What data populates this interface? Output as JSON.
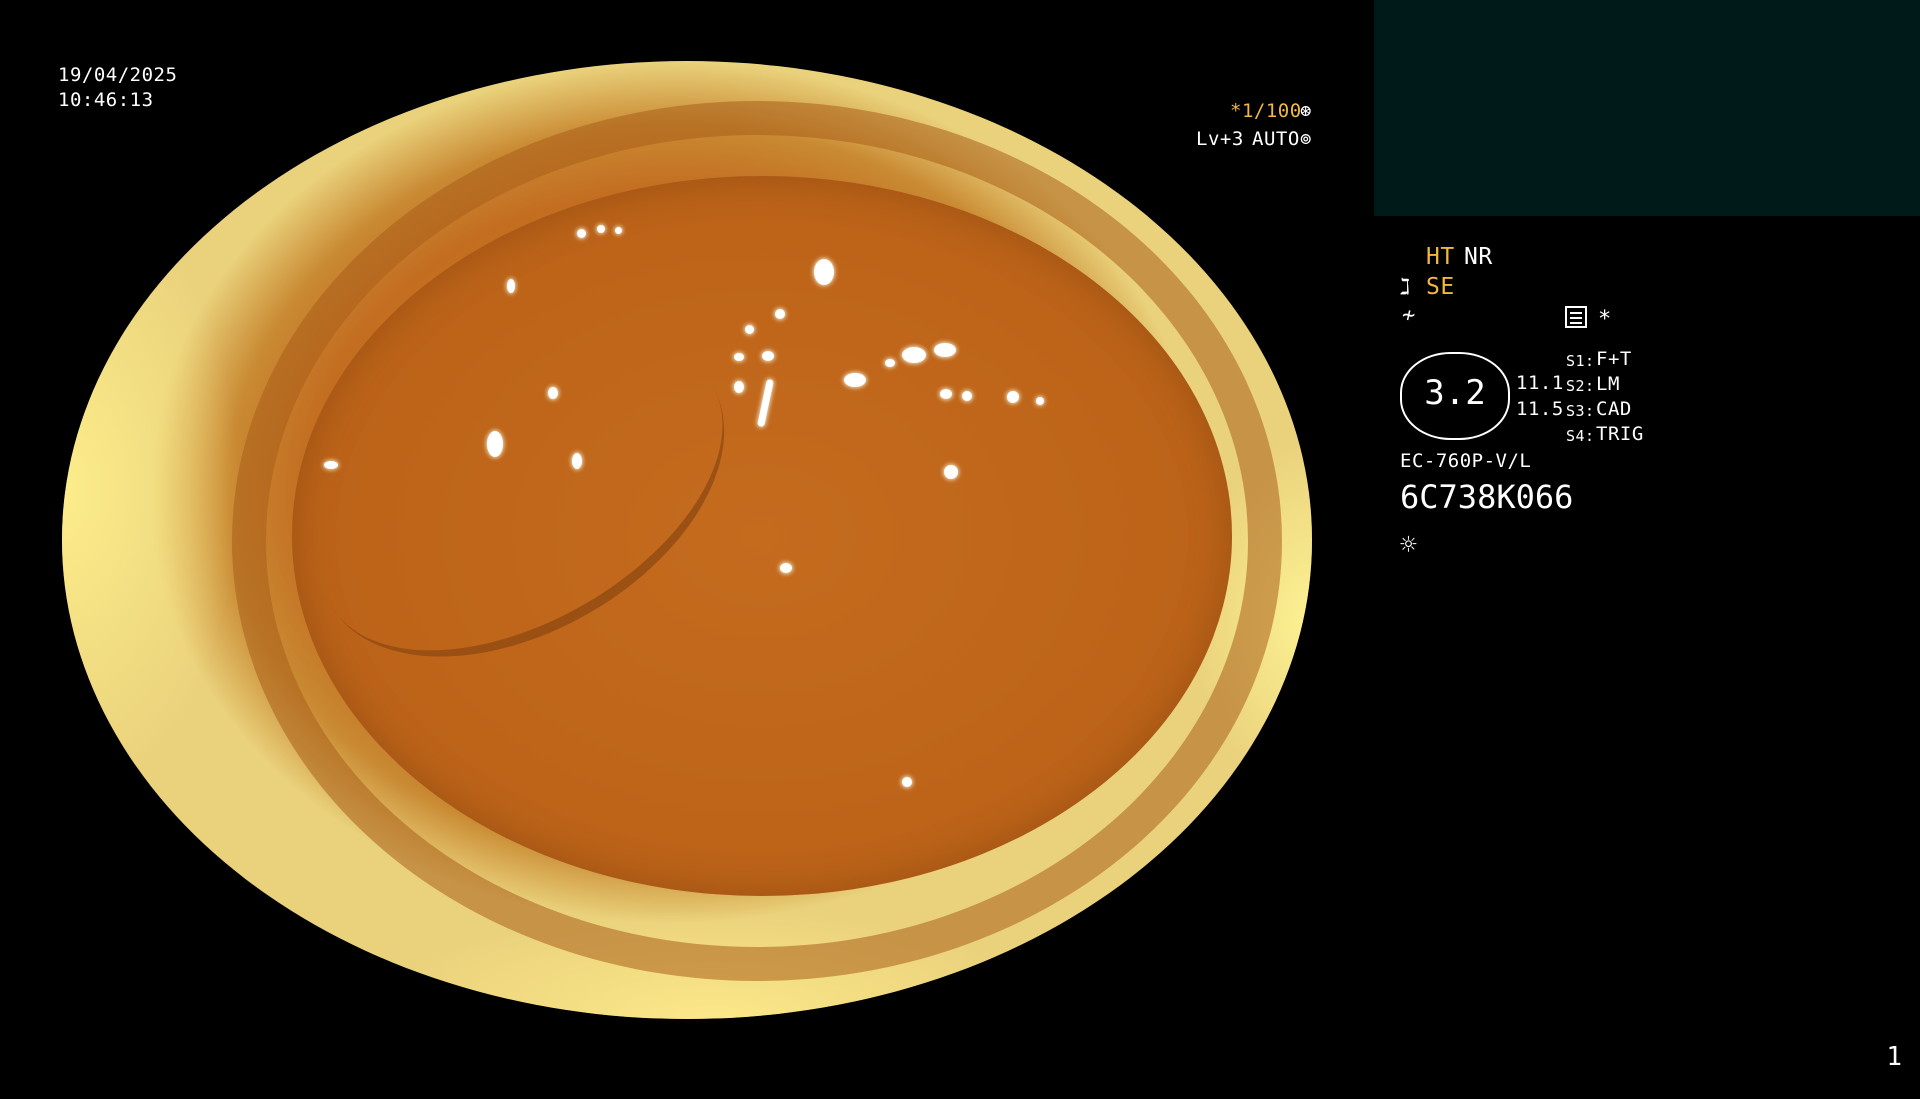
{
  "datetime": {
    "date": "19/04/2025",
    "time": "10:46:13"
  },
  "shutter": {
    "value": "*1/100",
    "icon": "shutter-icon"
  },
  "iris": {
    "level": "Lv+3",
    "mode": "AUTO",
    "icon": "iris-icon"
  },
  "image_modes": {
    "ht": "HT",
    "nr": "NR",
    "se": "SE"
  },
  "modes_icons": {
    "enhance": "enhance-icon",
    "structure": "structure-icon",
    "settings": "settings-icon",
    "star": "*"
  },
  "scope": {
    "value": "3.2",
    "param1": "11.1",
    "param2": "11.5",
    "s1_key": "S1:",
    "s1_val": "F+T",
    "s2_key": "S2:",
    "s2_val": "LM",
    "s3_key": "S3:",
    "s3_val": "CAD",
    "s4_key": "S4:",
    "s4_val": "TRIG",
    "model": "EC-760P-V/L",
    "serial": "6C738K066"
  },
  "light_icon": "light-icon",
  "page_number": "1",
  "colors": {
    "background": "#000000",
    "accent_orange": "#f2b740",
    "info_box": "#001a1a"
  }
}
